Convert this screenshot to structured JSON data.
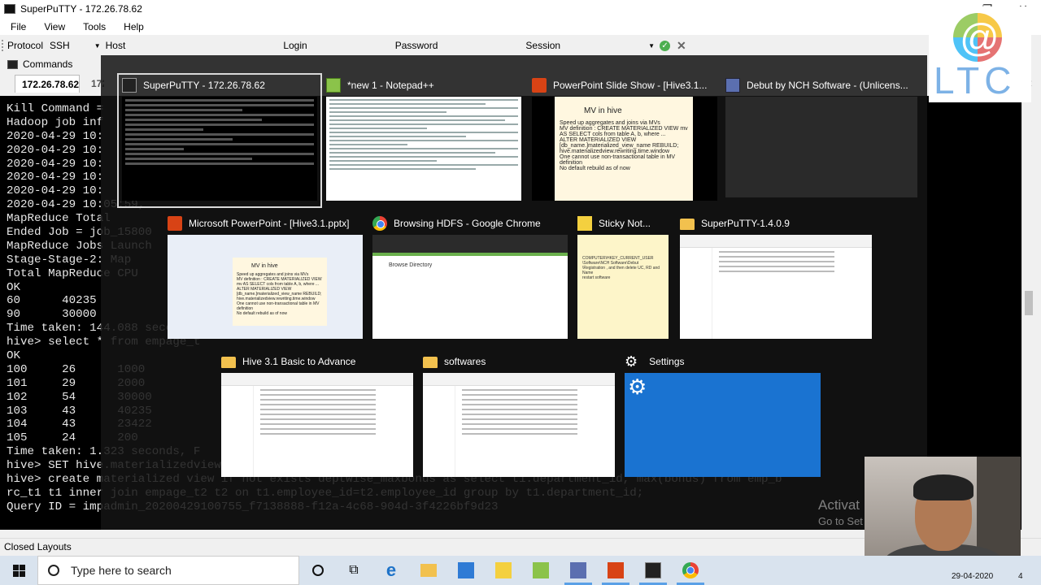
{
  "window": {
    "title": "SuperPuTTY - 172.26.78.62",
    "controls": [
      "—",
      "❐",
      "✕"
    ]
  },
  "menu": [
    "File",
    "View",
    "Tools",
    "Help"
  ],
  "toolbar": {
    "protocol_label": "Protocol",
    "protocol_value": "SSH",
    "host_label": "Host",
    "login_label": "Login",
    "password_label": "Password",
    "session_label": "Session"
  },
  "commands_label": "Commands",
  "tabs": [
    {
      "label": "172.26.78.62"
    },
    {
      "label": "172"
    }
  ],
  "tab_controls": "▾ ✕",
  "terminal_lines": [
    "Kill Command =",
    "Hadoop job inf",
    "2020-04-29 10:",
    "2020-04-29 10:",
    "2020-04-29 10:",
    "2020-04-29 10:",
    "2020-04-29 10:",
    "2020-04-29 10:05:59,",
    "MapReduce Total",
    "Ended Job = job_15800",
    "MapReduce Jobs Launch",
    "Stage-Stage-2: Map",
    "Total MapReduce CPU",
    "OK",
    "60      40235",
    "90      30000",
    "Time taken: 144.088 seconds, Fetched: 2 row(s)",
    "hive> select * from empage_t",
    "OK",
    "100     26      1000",
    "101     29      2000",
    "102     54      30000",
    "103     43      40235",
    "104     43      23422",
    "105     24      200",
    "Time taken: 1.323 seconds, F",
    "hive> SET hive.materializedview.rewriting=true;",
    "hive> create materialized view if not exists deptwise_maxbonus as select t1.department_id, max(bonus) from emp_b",
    "rc_t1 t1 inner join empage_t2 t2 on t1.employee_id=t2.employee_id group by t1.department_id;",
    "Query ID = impadmin_20200429100755_f7138888-f12a-4c68-904d-3f4226bf9d23"
  ],
  "status_bar": "Closed Layouts",
  "logo_text": "LTC",
  "switcher": {
    "windows": [
      {
        "title": "SuperPuTTY - 172.26.78.62",
        "icon": "terminal-icon",
        "selected": true
      },
      {
        "title": "*new 1 - Notepad++",
        "icon": "notepad-plus-icon"
      },
      {
        "title": "PowerPoint Slide Show - [Hive3.1...",
        "icon": "powerpoint-icon"
      },
      {
        "title": "Debut by NCH Software - (Unlicens...",
        "icon": "debut-icon"
      },
      {
        "title": "Microsoft PowerPoint - [Hive3.1.pptx]",
        "icon": "powerpoint-icon"
      },
      {
        "title": "Browsing HDFS - Google Chrome",
        "icon": "chrome-icon"
      },
      {
        "title": "Sticky Not...",
        "icon": "sticky-notes-icon"
      },
      {
        "title": "SuperPuTTY-1.4.0.9",
        "icon": "folder-icon"
      },
      {
        "title": "Hive 3.1 Basic to Advance",
        "icon": "folder-icon"
      },
      {
        "title": "softwares",
        "icon": "folder-icon"
      },
      {
        "title": "Settings",
        "icon": "gear-icon"
      }
    ],
    "slide": {
      "heading": "MV in hive",
      "bullets": [
        "Speed up aggregates and joins via MVs",
        "MV definition : CREATE MATERIALIZED VIEW mv AS SELECT cols from table A, b, where ...",
        "ALTER MATERIALIZED VIEW [db_name.]materialized_view_name REBUILD;",
        "hive.materializedview.rewriting.time.window",
        "One cannot use non-transactional table in MV definition",
        "No default rebuild as of now"
      ]
    },
    "browse_heading": "Browse Directory",
    "sticky_lines": [
      "COMPUTER\\HKEY_CURRENT_USER",
      "\\Software\\NCH Software\\Debut",
      "\\Registration , and then delete UC, RD and",
      "Name",
      "restart software"
    ]
  },
  "watermark": {
    "line1": "Activat",
    "line2": "Go to Set"
  },
  "taskbar": {
    "search_placeholder": "Type here to search",
    "date": "29-04-2020",
    "notification_count": "4"
  },
  "colors": {
    "terminal_bg": "#000000",
    "terminal_fg": "#e8e8e8",
    "settings_tile": "#1a73d1",
    "switcher_bg": "#141414"
  }
}
